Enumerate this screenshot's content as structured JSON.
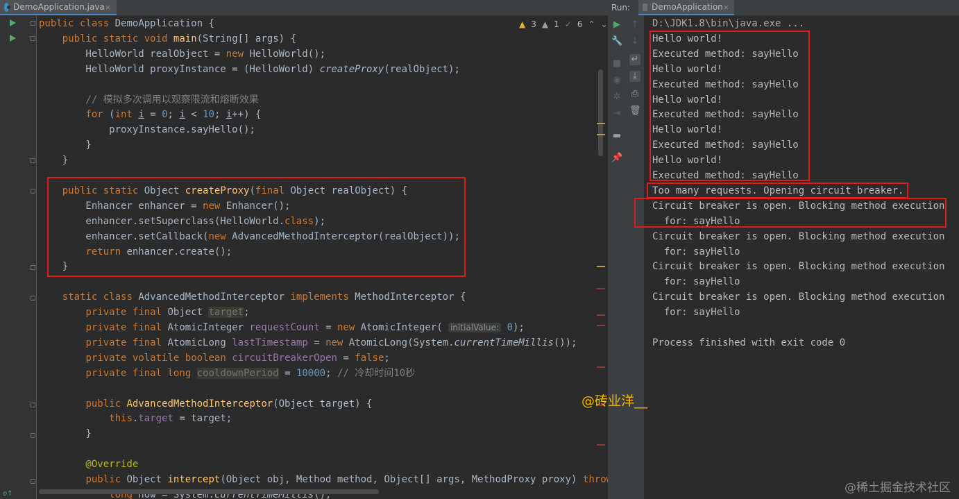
{
  "editor": {
    "tab_label": "DemoApplication.java",
    "tab_close": "×",
    "inspection": {
      "warnings": "3",
      "weak_warnings": "1",
      "ok": "6"
    },
    "code_lines": [
      "public class DemoApplication {",
      "    public static void main(String[] args) {",
      "        HelloWorld realObject = new HelloWorld();",
      "        HelloWorld proxyInstance = (HelloWorld) createProxy(realObject);",
      "",
      "        // 模拟多次调用以观察限流和熔断效果",
      "        for (int i = 0; i < 10; i++) {",
      "            proxyInstance.sayHello();",
      "        }",
      "    }",
      "",
      "    public static Object createProxy(final Object realObject) {",
      "        Enhancer enhancer = new Enhancer();",
      "        enhancer.setSuperclass(HelloWorld.class);",
      "        enhancer.setCallback(new AdvancedMethodInterceptor(realObject));",
      "        return enhancer.create();",
      "    }",
      "",
      "    static class AdvancedMethodInterceptor implements MethodInterceptor {",
      "        private final Object target;",
      "        private final AtomicInteger requestCount = new AtomicInteger( initialValue: 0);",
      "        private final AtomicLong lastTimestamp = new AtomicLong(System.currentTimeMillis());",
      "        private volatile boolean circuitBreakerOpen = false;",
      "        private final long cooldownPeriod = 10000; // 冷却时间10秒",
      "",
      "        public AdvancedMethodInterceptor(Object target) {",
      "            this.target = target;",
      "        }",
      "",
      "        @Override",
      "        public Object intercept(Object obj, Method method, Object[] args, MethodProxy proxy) throws",
      "            long now = System.currentTimeMillis();"
    ]
  },
  "run_panel": {
    "label": "Run:",
    "tab_label": "DemoApplication",
    "tab_close": "×",
    "console_lines": [
      "D:\\JDK1.8\\bin\\java.exe ...",
      "Hello world!",
      "Executed method: sayHello",
      "Hello world!",
      "Executed method: sayHello",
      "Hello world!",
      "Executed method: sayHello",
      "Hello world!",
      "Executed method: sayHello",
      "Hello world!",
      "Executed method: sayHello",
      "Too many requests. Opening circuit breaker.",
      "Circuit breaker is open. Blocking method execution",
      "  for: sayHello",
      "Circuit breaker is open. Blocking method execution",
      "  for: sayHello",
      "Circuit breaker is open. Blocking method execution",
      "  for: sayHello",
      "Circuit breaker is open. Blocking method execution",
      "  for: sayHello",
      "",
      "Process finished with exit code 0"
    ]
  },
  "overlay": {
    "watermark_author": "@砖业洋__",
    "watermark_site": "@稀土掘金技术社区"
  },
  "colors": {
    "keyword": "#cc7832",
    "method_decl": "#ffc66d",
    "number": "#6897bb",
    "comment": "#808080",
    "field": "#9876aa",
    "annotation_box": "#e01b1b",
    "run_green": "#59a869"
  },
  "icons": {
    "run_gutter": "play-icon",
    "rerun": "rerun-icon",
    "settings": "wrench-icon",
    "stop": "stop-icon",
    "camera": "camera-icon",
    "soft_wrap": "soft-wrap-icon",
    "scroll_end": "scroll-to-end-icon",
    "print": "print-icon",
    "clear": "trash-icon",
    "pin": "pin-icon"
  }
}
